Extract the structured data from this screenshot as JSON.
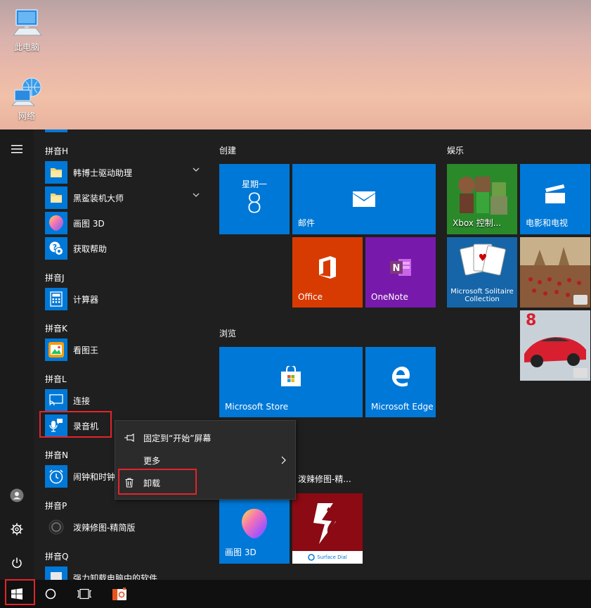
{
  "desktop": {
    "icons": [
      {
        "label": "此电脑",
        "icon": "computer-icon"
      },
      {
        "label": "网络",
        "icon": "network-icon"
      }
    ]
  },
  "rail": {
    "icons": [
      "hamburger-menu-icon",
      "user-icon",
      "settings-gear-icon",
      "power-icon"
    ]
  },
  "applist": {
    "groups": [
      {
        "header": "拼音H"
      },
      {
        "header": "拼音J"
      },
      {
        "header": "拼音K"
      },
      {
        "header": "拼音L"
      },
      {
        "header": "拼音N"
      },
      {
        "header": "拼音P"
      },
      {
        "header": "拼音Q"
      }
    ],
    "apps": [
      {
        "label": "韩博士驱动助理",
        "icon": "folder-icon",
        "expandable": true
      },
      {
        "label": "黑鲨装机大师",
        "icon": "folder-icon",
        "expandable": true
      },
      {
        "label": "画图 3D",
        "icon": "paint3d-icon"
      },
      {
        "label": "获取帮助",
        "icon": "help-icon"
      },
      {
        "label": "计算器",
        "icon": "calculator-icon"
      },
      {
        "label": "看图王",
        "icon": "image-viewer-icon"
      },
      {
        "label": "连接",
        "icon": "connect-icon"
      },
      {
        "label": "录音机",
        "icon": "voice-recorder-icon",
        "selected": true
      },
      {
        "label": "闹钟和时钟",
        "icon": "alarm-clock-icon"
      },
      {
        "label": "泼辣修图-精简版",
        "icon": "polarr-icon"
      },
      {
        "label": "强力卸载电脑中的软件",
        "icon": "uninstaller-icon"
      }
    ]
  },
  "tiles": {
    "sections": [
      {
        "header": "创建"
      },
      {
        "header": "浏览"
      },
      {
        "header": "娱乐"
      }
    ],
    "items": [
      {
        "label": "星期一",
        "sub": "8",
        "kind": "calendar",
        "color": "#0078d7"
      },
      {
        "label": "邮件",
        "kind": "mail",
        "color": "#0078d7"
      },
      {
        "label": "Office",
        "kind": "office",
        "color": "#d83b01"
      },
      {
        "label": "OneNote",
        "kind": "onenote",
        "color": "#7719aa"
      },
      {
        "label": "Microsoft Store",
        "kind": "store",
        "color": "#0078d7"
      },
      {
        "label": "Microsoft Edge",
        "kind": "edge",
        "color": "#0078d7"
      },
      {
        "label": "泼辣修图-精...",
        "kind": "polarr",
        "color": "#1f1f1f"
      },
      {
        "label": "画图 3D",
        "kind": "paint3d",
        "color": "#0078d7"
      },
      {
        "label": "Surface Dial",
        "kind": "surfacedial",
        "color": "#8b0a14"
      },
      {
        "label": "Xbox 控制...",
        "kind": "xbox",
        "color": "#107c10"
      },
      {
        "label": "电影和电视",
        "kind": "movies",
        "color": "#0078d7"
      },
      {
        "label": "Microsoft Solitaire Collection",
        "kind": "solitaire",
        "color": "#ffffff"
      },
      {
        "label": "",
        "kind": "game-strategy",
        "color": "#b08050"
      },
      {
        "label": "8",
        "kind": "game-racing",
        "color": "#cfd6dc"
      }
    ]
  },
  "context_menu": {
    "items": [
      {
        "label": "固定到“开始”屏幕",
        "icon": "pin-icon"
      },
      {
        "label": "更多",
        "icon": "",
        "has_submenu": true
      },
      {
        "label": "卸载",
        "icon": "trash-icon"
      }
    ]
  },
  "taskbar": {
    "icons": [
      "windows-start-icon",
      "cortana-circle-icon",
      "task-view-icon",
      "polarr-taskbar-icon"
    ]
  },
  "colors": {
    "accent": "#0078d7",
    "highlight": "#e3242b"
  }
}
